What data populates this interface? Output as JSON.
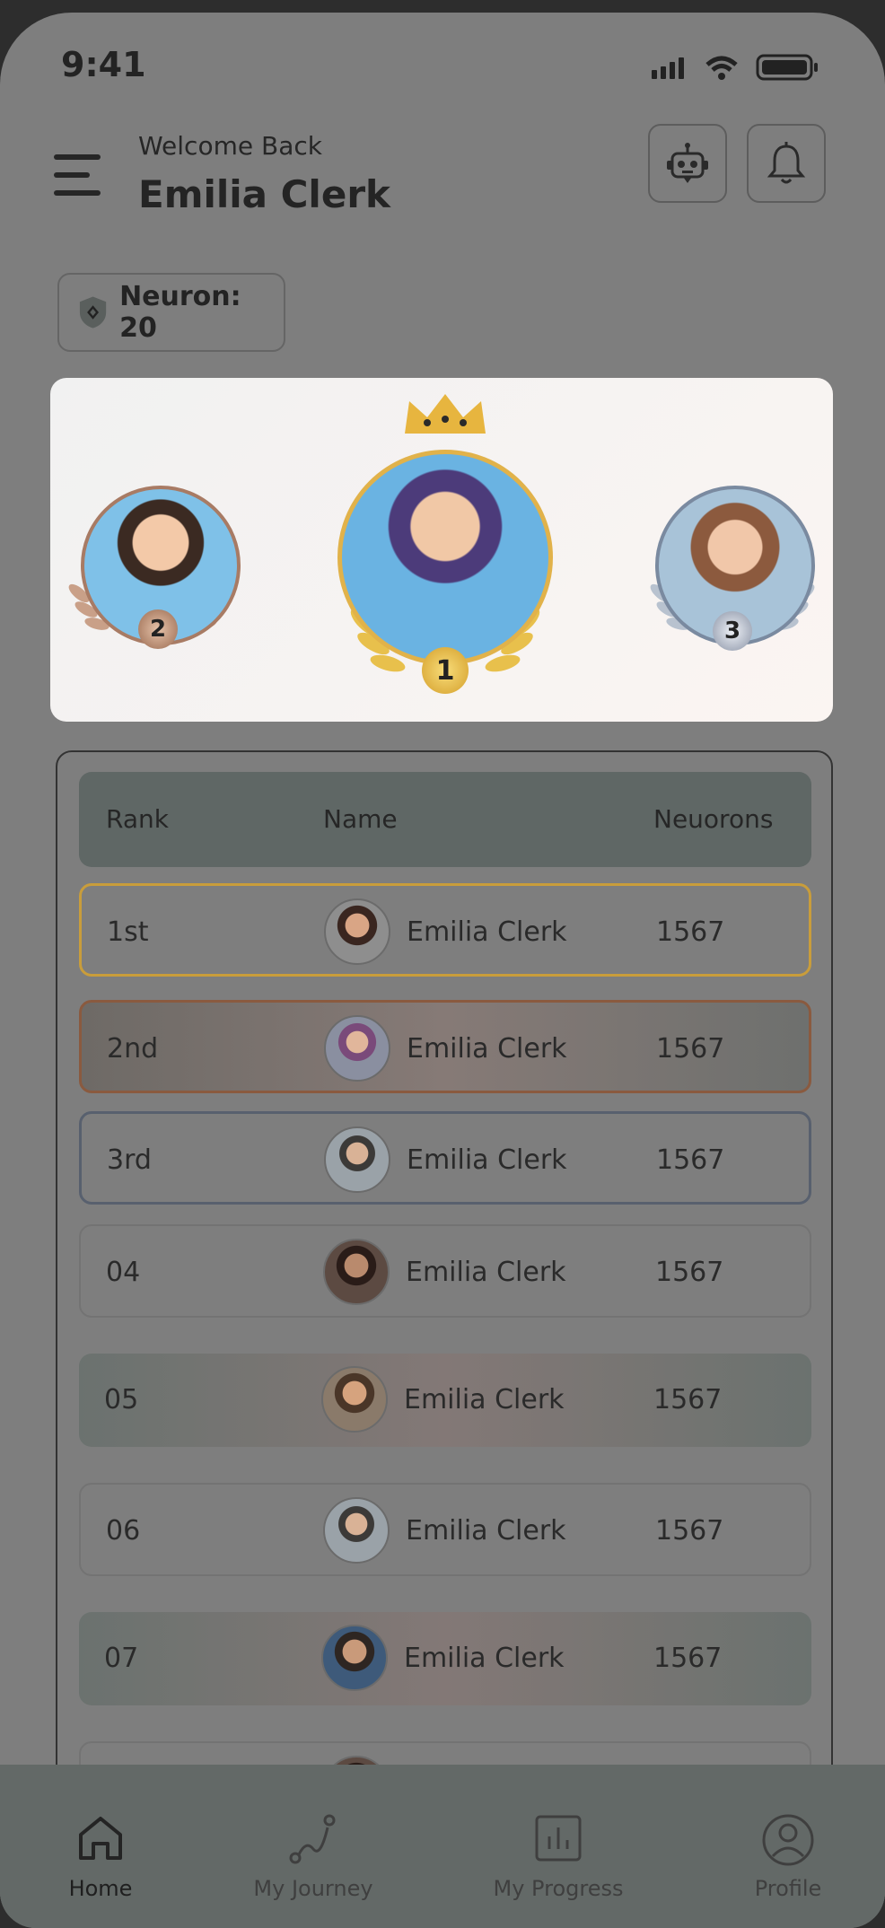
{
  "status_bar": {
    "time": "9:41"
  },
  "header": {
    "greeting": "Welcome Back",
    "username": "Emilia Clerk"
  },
  "neuron_chip": {
    "label": "Neuron: 20"
  },
  "podium": {
    "first": {
      "rank": "1"
    },
    "second": {
      "rank": "2"
    },
    "third": {
      "rank": "3"
    }
  },
  "leaderboard": {
    "columns": {
      "rank": "Rank",
      "name": "Name",
      "score": "Neuorons"
    },
    "rows": [
      {
        "rank": "1st",
        "name": "Emilia Clerk",
        "score": "1567"
      },
      {
        "rank": "2nd",
        "name": "Emilia Clerk",
        "score": "1567"
      },
      {
        "rank": "3rd",
        "name": "Emilia Clerk",
        "score": "1567"
      },
      {
        "rank": "04",
        "name": "Emilia Clerk",
        "score": "1567"
      },
      {
        "rank": "05",
        "name": "Emilia Clerk",
        "score": "1567"
      },
      {
        "rank": "06",
        "name": "Emilia Clerk",
        "score": "1567"
      },
      {
        "rank": "07",
        "name": "Emilia Clerk",
        "score": "1567"
      }
    ]
  },
  "bottom_nav": {
    "items": [
      {
        "label": "Home",
        "icon": "home-icon",
        "active": true
      },
      {
        "label": "My Journey",
        "icon": "journey-icon"
      },
      {
        "label": "My Progress",
        "icon": "progress-chart-icon"
      },
      {
        "label": "Profile",
        "icon": "profile-icon"
      }
    ]
  },
  "colors": {
    "gold": "#e8b84a",
    "bronze": "#9a6a50",
    "silver": "#8a93a6",
    "overlay": "#7e7e7e"
  }
}
